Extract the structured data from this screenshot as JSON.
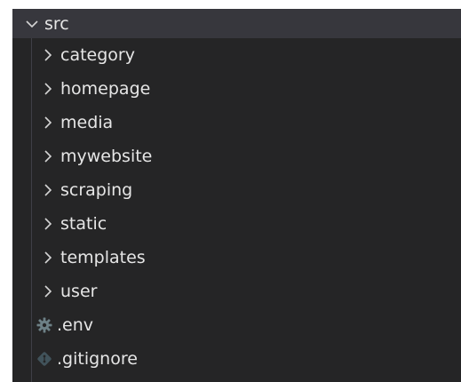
{
  "explorer": {
    "root": {
      "label": "src",
      "state": "expanded",
      "icon": "chevron-down-icon"
    },
    "folders": [
      {
        "label": "category",
        "icon": "chevron-right-icon"
      },
      {
        "label": "homepage",
        "icon": "chevron-right-icon"
      },
      {
        "label": "media",
        "icon": "chevron-right-icon"
      },
      {
        "label": "mywebsite",
        "icon": "chevron-right-icon"
      },
      {
        "label": "scraping",
        "icon": "chevron-right-icon"
      },
      {
        "label": "static",
        "icon": "chevron-right-icon"
      },
      {
        "label": "templates",
        "icon": "chevron-right-icon"
      },
      {
        "label": "user",
        "icon": "chevron-right-icon"
      }
    ],
    "files": [
      {
        "label": ".env",
        "icon": "gear-icon",
        "icon_color": "#6d8086"
      },
      {
        "label": ".gitignore",
        "icon": "git-icon",
        "icon_color": "#41535b"
      }
    ]
  },
  "colors": {
    "background": "#252526",
    "root_row_highlight": "#37373d",
    "text": "#e6e6e6"
  }
}
